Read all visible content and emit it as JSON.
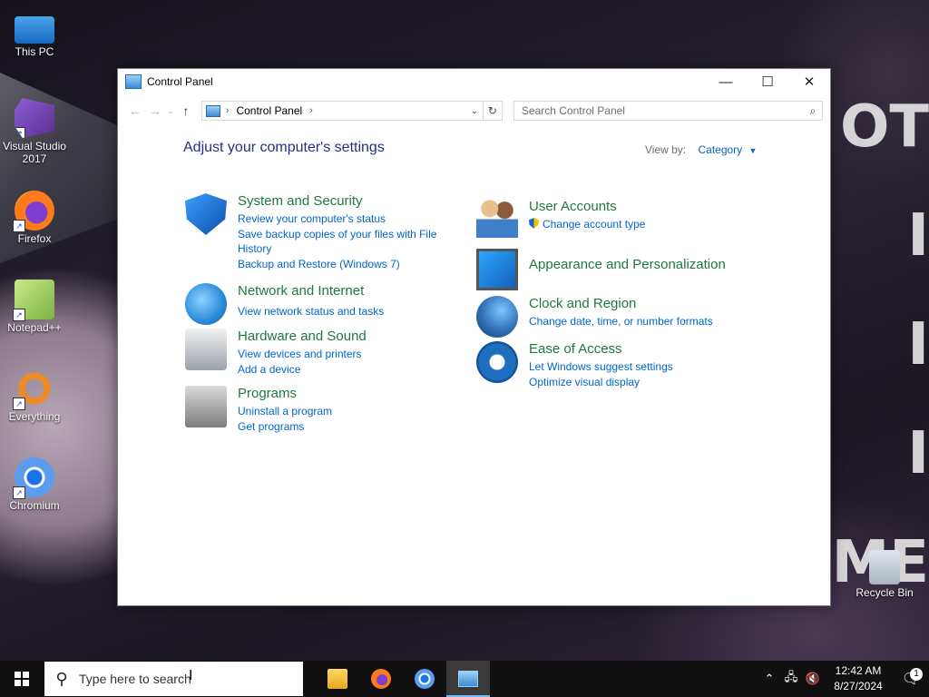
{
  "desktop": {
    "icons": [
      {
        "label": "This PC"
      },
      {
        "label": "Visual Studio 2017"
      },
      {
        "label": "Firefox"
      },
      {
        "label": "Notepad++"
      },
      {
        "label": "Everything"
      },
      {
        "label": "Chromium"
      },
      {
        "label": "Recycle Bin"
      }
    ]
  },
  "window": {
    "title": "Control Panel",
    "controls": {
      "minimize": "—",
      "maximize": "☐",
      "close": "✕"
    },
    "address": {
      "crumb": "Control Panel",
      "separator": "›"
    },
    "search": {
      "placeholder": "Search Control Panel"
    },
    "heading": "Adjust your computer's settings",
    "view_by": {
      "label": "View by:",
      "value": "Category"
    },
    "categories_left": [
      {
        "title": "System and Security",
        "links": [
          "Review your computer's status",
          "Save backup copies of your files with File History",
          "Backup and Restore (Windows 7)"
        ]
      },
      {
        "title": "Network and Internet",
        "links": [
          "View network status and tasks"
        ]
      },
      {
        "title": "Hardware and Sound",
        "links": [
          "View devices and printers",
          "Add a device"
        ]
      },
      {
        "title": "Programs",
        "links": [
          "Uninstall a program",
          "Get programs"
        ]
      }
    ],
    "categories_right": [
      {
        "title": "User Accounts",
        "links": [
          "Change account type"
        ]
      },
      {
        "title": "Appearance and Personalization",
        "links": []
      },
      {
        "title": "Clock and Region",
        "links": [
          "Change date, time, or number formats"
        ]
      },
      {
        "title": "Ease of Access",
        "links": [
          "Let Windows suggest settings",
          "Optimize visual display"
        ]
      }
    ]
  },
  "taskbar": {
    "search_text": "Type here to search",
    "apps": [
      "file-explorer",
      "firefox",
      "chromium",
      "control-panel"
    ],
    "clock": {
      "time": "12:42 AM",
      "date": "8/27/2024"
    },
    "notification_count": "1"
  }
}
